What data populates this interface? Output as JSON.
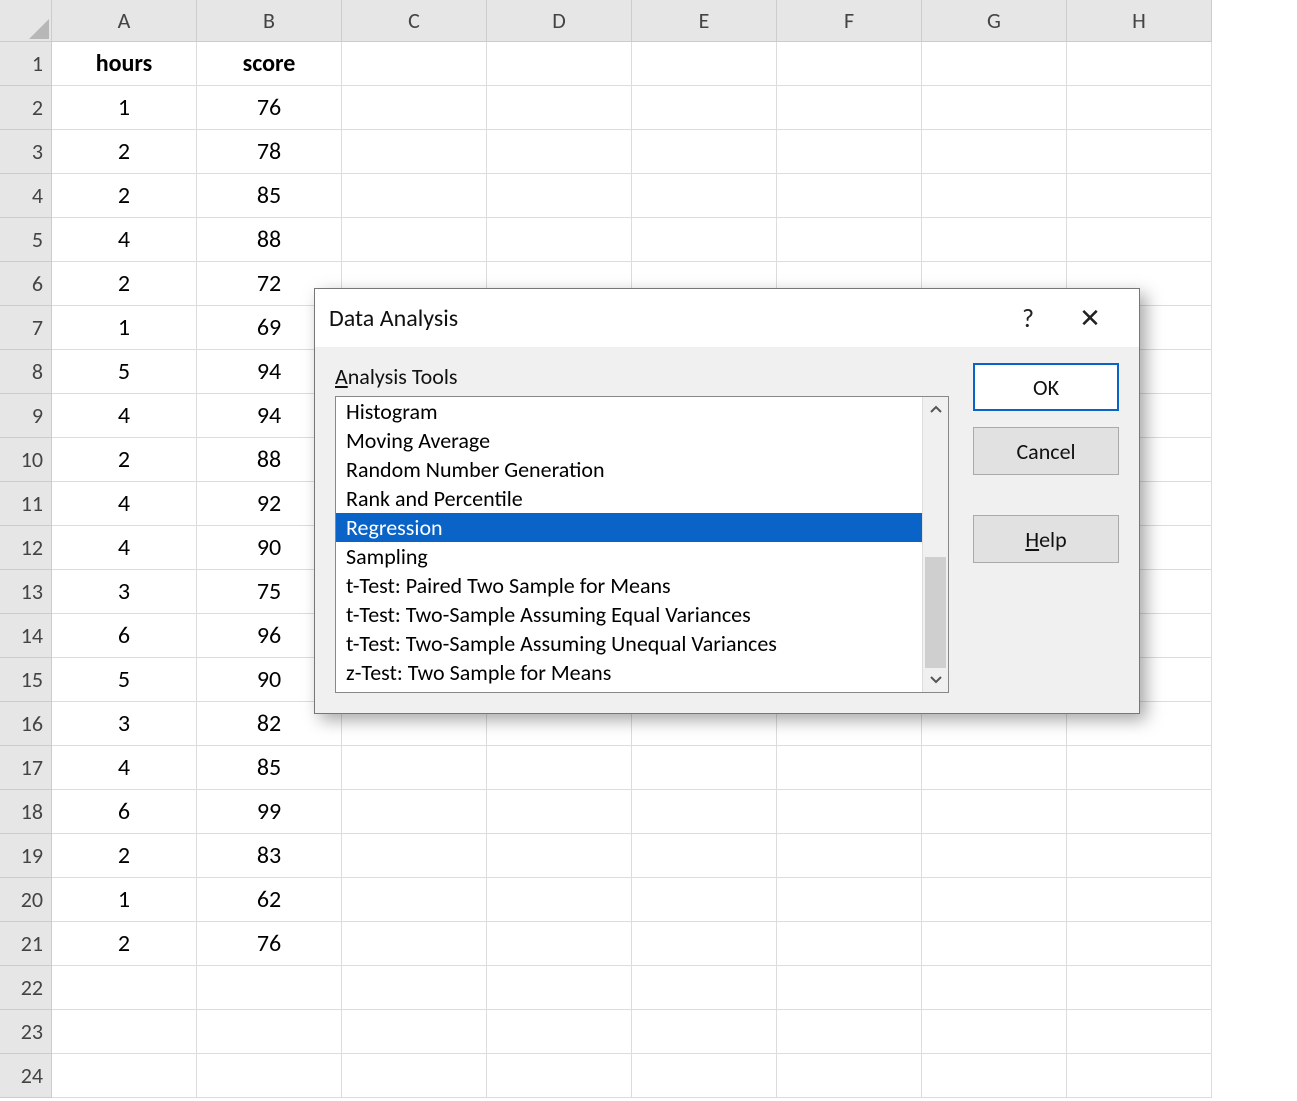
{
  "spreadsheet": {
    "columns": [
      "A",
      "B",
      "C",
      "D",
      "E",
      "F",
      "G",
      "H"
    ],
    "rowCount": 24,
    "headers": {
      "A": "hours",
      "B": "score"
    },
    "data": [
      {
        "A": "1",
        "B": "76"
      },
      {
        "A": "2",
        "B": "78"
      },
      {
        "A": "2",
        "B": "85"
      },
      {
        "A": "4",
        "B": "88"
      },
      {
        "A": "2",
        "B": "72"
      },
      {
        "A": "1",
        "B": "69"
      },
      {
        "A": "5",
        "B": "94"
      },
      {
        "A": "4",
        "B": "94"
      },
      {
        "A": "2",
        "B": "88"
      },
      {
        "A": "4",
        "B": "92"
      },
      {
        "A": "4",
        "B": "90"
      },
      {
        "A": "3",
        "B": "75"
      },
      {
        "A": "6",
        "B": "96"
      },
      {
        "A": "5",
        "B": "90"
      },
      {
        "A": "3",
        "B": "82"
      },
      {
        "A": "4",
        "B": "85"
      },
      {
        "A": "6",
        "B": "99"
      },
      {
        "A": "2",
        "B": "83"
      },
      {
        "A": "1",
        "B": "62"
      },
      {
        "A": "2",
        "B": "76"
      }
    ]
  },
  "dialog": {
    "title": "Data Analysis",
    "groupLabelPrefix": "A",
    "groupLabelRest": "nalysis Tools",
    "items": [
      "Histogram",
      "Moving Average",
      "Random Number Generation",
      "Rank and Percentile",
      "Regression",
      "Sampling",
      "t-Test: Paired Two Sample for Means",
      "t-Test: Two-Sample Assuming Equal Variances",
      "t-Test: Two-Sample Assuming Unequal Variances",
      "z-Test: Two Sample for Means"
    ],
    "selectedIndex": 4,
    "buttons": {
      "ok": "OK",
      "cancel": "Cancel",
      "helpPrefix": "H",
      "helpRest": "elp"
    },
    "helpIcon": "?",
    "closeIcon": "✕"
  }
}
